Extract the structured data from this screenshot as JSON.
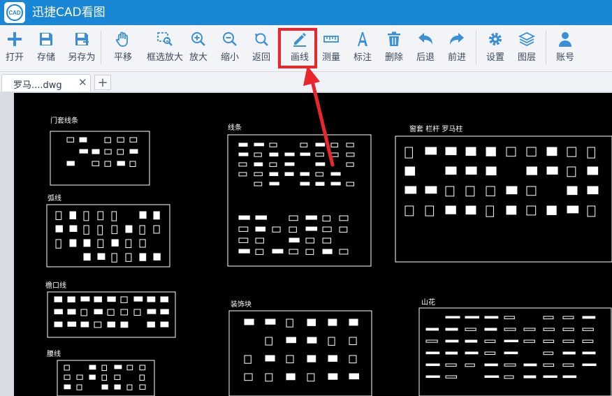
{
  "app": {
    "title": "迅捷CAD看图",
    "logo_text": "CAD"
  },
  "toolbar": {
    "items": [
      {
        "id": "open",
        "label": "打开",
        "icon": "plus-icon"
      },
      {
        "id": "save",
        "label": "存储",
        "icon": "save-icon"
      },
      {
        "id": "save_as",
        "label": "另存为",
        "icon": "save-as-icon"
      },
      {
        "id": "pan",
        "label": "平移",
        "icon": "hand-icon"
      },
      {
        "id": "window_zoom",
        "label": "框选放大",
        "icon": "window-zoom-icon"
      },
      {
        "id": "zoom_in",
        "label": "放大",
        "icon": "zoom-in-icon"
      },
      {
        "id": "zoom_out",
        "label": "缩小",
        "icon": "zoom-out-icon"
      },
      {
        "id": "back",
        "label": "返回",
        "icon": "zoom-back-icon"
      },
      {
        "id": "draw_line",
        "label": "画线",
        "icon": "pencil-icon"
      },
      {
        "id": "measure",
        "label": "测量",
        "icon": "ruler-icon"
      },
      {
        "id": "annotate",
        "label": "标注",
        "icon": "letter-a-icon"
      },
      {
        "id": "delete",
        "label": "删除",
        "icon": "trash-icon"
      },
      {
        "id": "undo",
        "label": "后退",
        "icon": "undo-icon"
      },
      {
        "id": "redo",
        "label": "前进",
        "icon": "redo-icon"
      },
      {
        "id": "settings",
        "label": "设置",
        "icon": "gear-icon"
      },
      {
        "id": "layers",
        "label": "图层",
        "icon": "layers-icon"
      },
      {
        "id": "account",
        "label": "账号",
        "icon": "user-icon"
      }
    ]
  },
  "tabs": [
    {
      "label": "罗马....dwg"
    }
  ],
  "drawing": {
    "sections": [
      "门套线条",
      "线条",
      "窗套 栏杆 罗马柱",
      "弧线",
      "檐口线",
      "装饰块",
      "山花",
      "腰线"
    ]
  },
  "colors": {
    "titlebar": "#1a86d6",
    "icon": "#3a8fd6",
    "highlight": "#e8262b",
    "canvas": "#000000"
  }
}
